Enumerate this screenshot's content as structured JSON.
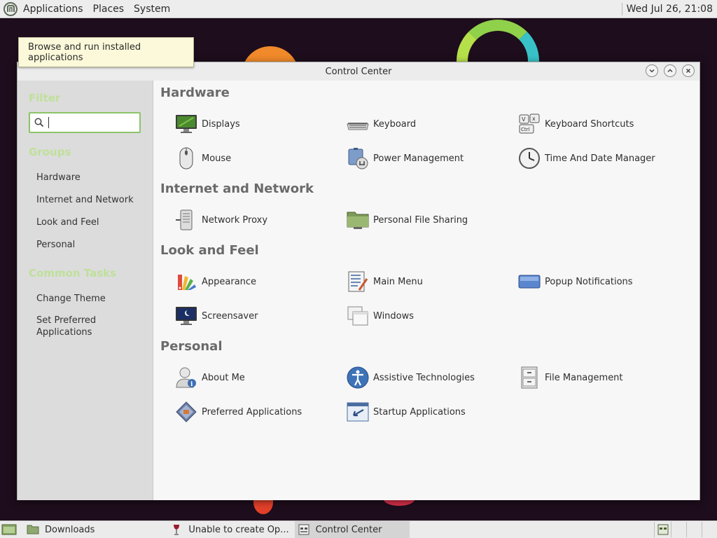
{
  "top_panel": {
    "menus": [
      "Applications",
      "Places",
      "System"
    ],
    "clock": "Wed Jul 26, 21:08"
  },
  "tooltip": {
    "text": "Browse and run installed applications"
  },
  "window": {
    "title": "Control Center"
  },
  "sidebar": {
    "filter_heading": "Filter",
    "search_value": "",
    "groups_heading": "Groups",
    "groups": [
      "Hardware",
      "Internet and Network",
      "Look and Feel",
      "Personal"
    ],
    "tasks_heading": "Common Tasks",
    "tasks": [
      "Change Theme",
      "Set Preferred Applications"
    ]
  },
  "sections": [
    {
      "title": "Hardware",
      "items": [
        {
          "label": "Displays",
          "icon": "display-icon"
        },
        {
          "label": "Keyboard",
          "icon": "keyboard-icon"
        },
        {
          "label": "Keyboard Shortcuts",
          "icon": "keyboard-shortcuts-icon"
        },
        {
          "label": "Mouse",
          "icon": "mouse-icon"
        },
        {
          "label": "Power Management",
          "icon": "power-management-icon"
        },
        {
          "label": "Time And Date Manager",
          "icon": "clock-icon"
        }
      ]
    },
    {
      "title": "Internet and Network",
      "items": [
        {
          "label": "Network Proxy",
          "icon": "network-proxy-icon"
        },
        {
          "label": "Personal File Sharing",
          "icon": "folder-share-icon"
        }
      ]
    },
    {
      "title": "Look and Feel",
      "items": [
        {
          "label": "Appearance",
          "icon": "appearance-icon"
        },
        {
          "label": "Main Menu",
          "icon": "main-menu-icon"
        },
        {
          "label": "Popup Notifications",
          "icon": "notification-icon"
        },
        {
          "label": "Screensaver",
          "icon": "screensaver-icon"
        },
        {
          "label": "Windows",
          "icon": "windows-icon"
        }
      ]
    },
    {
      "title": "Personal",
      "items": [
        {
          "label": "About Me",
          "icon": "about-me-icon"
        },
        {
          "label": "Assistive Technologies",
          "icon": "accessibility-icon"
        },
        {
          "label": "File Management",
          "icon": "file-cabinet-icon"
        },
        {
          "label": "Preferred Applications",
          "icon": "preferred-apps-icon"
        },
        {
          "label": "Startup Applications",
          "icon": "startup-apps-icon"
        }
      ]
    }
  ],
  "taskbar": {
    "items": [
      "Downloads",
      "Unable to create Op...",
      "Control Center"
    ]
  }
}
